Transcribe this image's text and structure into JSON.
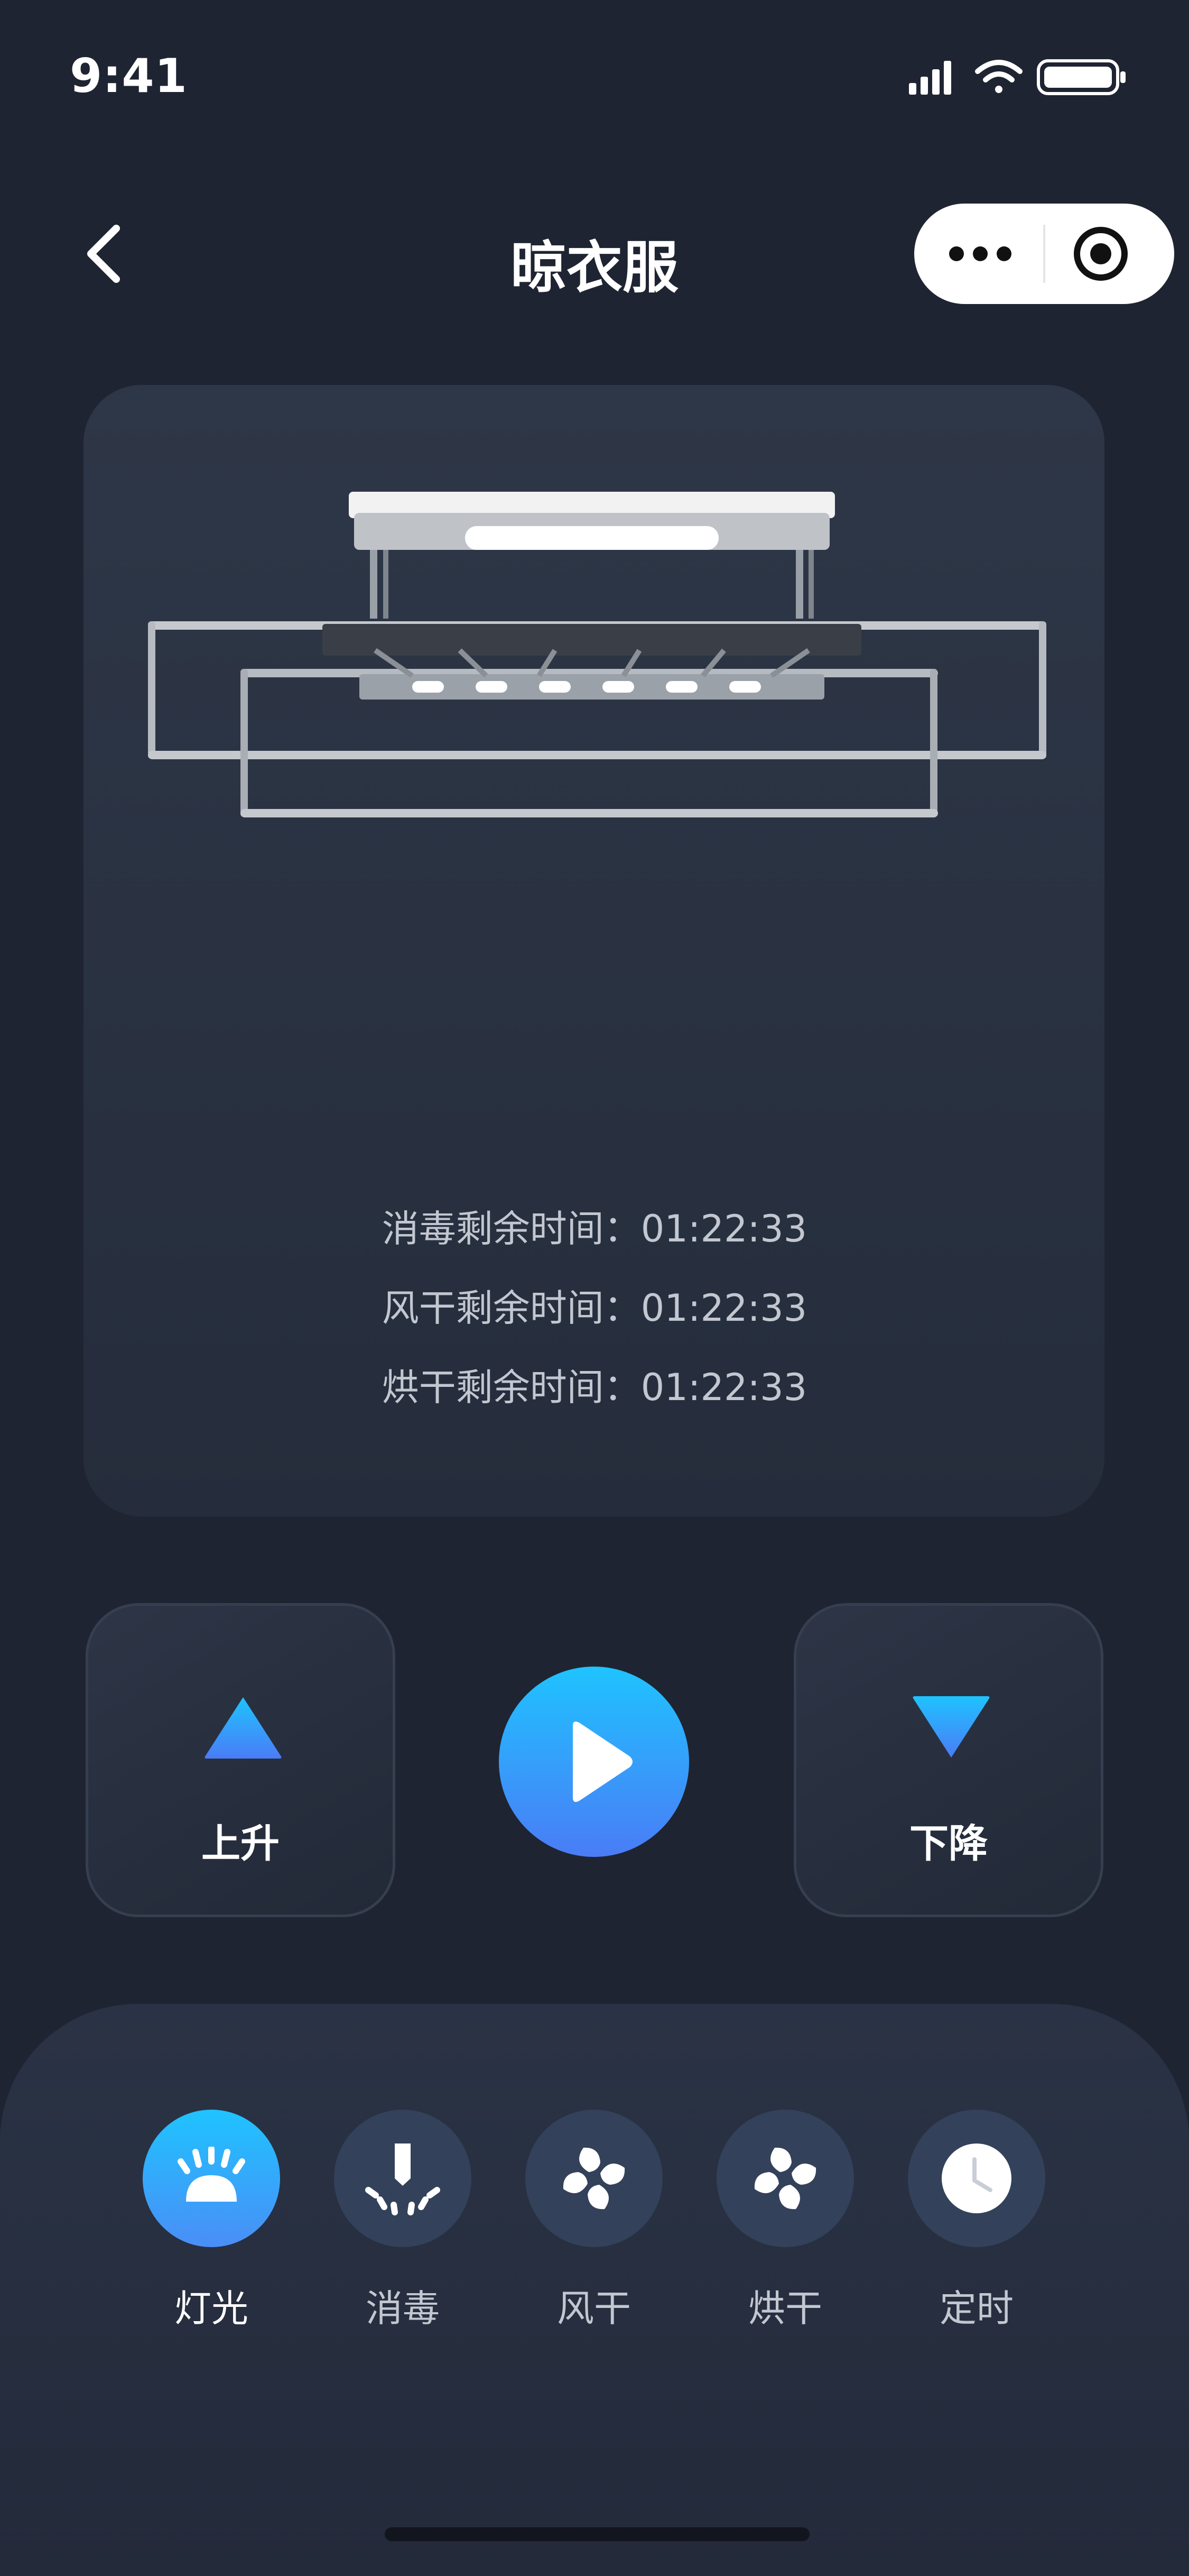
{
  "status_bar": {
    "time": "9:41"
  },
  "nav": {
    "title": "晾衣服"
  },
  "timers": [
    {
      "label": "消毒剩余时间：",
      "value": "01:22:33"
    },
    {
      "label": "风干剩余时间：",
      "value": "01:22:33"
    },
    {
      "label": "烘干剩余时间：",
      "value": "01:22:33"
    }
  ],
  "controls": {
    "up_label": "上升",
    "down_label": "下降"
  },
  "functions": [
    {
      "label": "灯光",
      "icon": "light-icon",
      "active": true
    },
    {
      "label": "消毒",
      "icon": "disinfect-icon",
      "active": false
    },
    {
      "label": "风干",
      "icon": "fan-icon",
      "active": false
    },
    {
      "label": "烘干",
      "icon": "fan-icon",
      "active": false
    },
    {
      "label": "定时",
      "icon": "clock-icon",
      "active": false
    }
  ],
  "colors": {
    "background": "#1f2432",
    "accent_start": "#1fc3ff",
    "accent_end": "#4a7cf6"
  }
}
